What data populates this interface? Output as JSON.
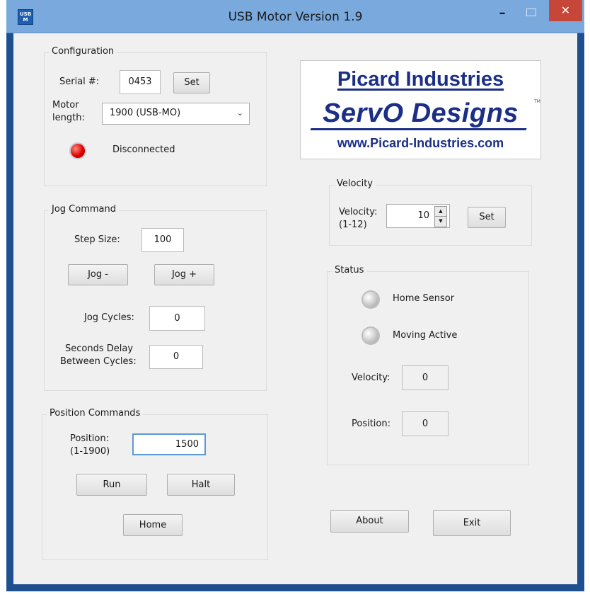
{
  "window": {
    "title": "USB Motor Version 1.9",
    "app_icon_text": "USB M",
    "minimize_glyph": "–",
    "close_glyph": "✕"
  },
  "configuration": {
    "title": "Configuration",
    "serial_label": "Serial #:",
    "serial_value": "0453",
    "set_label": "Set",
    "motor_length_label_1": "Motor",
    "motor_length_label_2": "length:",
    "motor_length_value": "1900 (USB-MO)",
    "connection_status": "Disconnected"
  },
  "logo": {
    "line1": "Picard Industries",
    "line2": "ServO Designs",
    "tm": "TM",
    "line3": "www.Picard-Industries.com"
  },
  "jog": {
    "title": "Jog Command",
    "step_size_label": "Step Size:",
    "step_size_value": "100",
    "jog_minus_label": "Jog -",
    "jog_plus_label": "Jog +",
    "jog_cycles_label": "Jog Cycles:",
    "jog_cycles_value": "0",
    "delay_label_1": "Seconds Delay",
    "delay_label_2": "Between Cycles:",
    "delay_value": "0"
  },
  "velocity": {
    "title": "Velocity",
    "label_1": "Velocity:",
    "label_2": "(1-12)",
    "value": "10",
    "set_label": "Set"
  },
  "status": {
    "title": "Status",
    "home_sensor_label": "Home Sensor",
    "moving_active_label": "Moving Active",
    "velocity_label": "Velocity:",
    "velocity_value": "0",
    "position_label": "Position:",
    "position_value": "0"
  },
  "position": {
    "title": "Position Commands",
    "label_1": "Position:",
    "label_2": "(1-1900)",
    "value": "1500",
    "run_label": "Run",
    "halt_label": "Halt",
    "home_label": "Home"
  },
  "footer": {
    "about_label": "About",
    "exit_label": "Exit"
  },
  "colors": {
    "titlebar": "#7aa9de",
    "close": "#c7463a",
    "led_red": "#e00000",
    "logo_blue": "#1b2f86"
  }
}
